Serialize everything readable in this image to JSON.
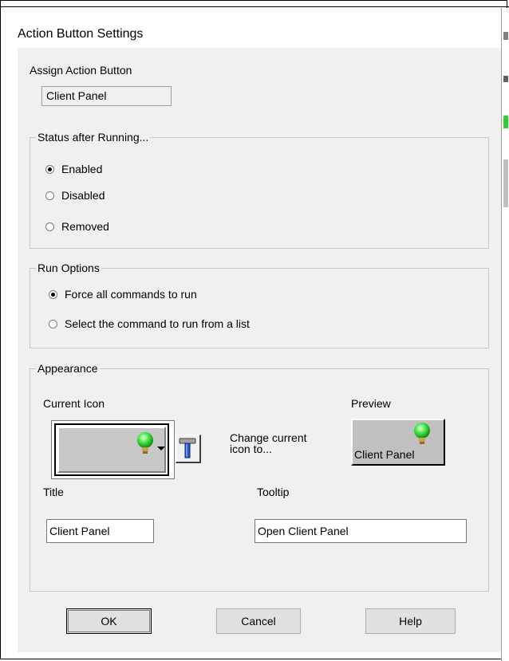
{
  "dialog": {
    "title": "Action Button Settings"
  },
  "assign": {
    "label": "Assign Action Button",
    "value": "Client Panel"
  },
  "status_after_running": {
    "caption": "Status after Running...",
    "options": [
      {
        "label": "Enabled",
        "checked": true
      },
      {
        "label": "Disabled",
        "checked": false
      },
      {
        "label": "Removed",
        "checked": false
      }
    ]
  },
  "run_options": {
    "caption": "Run Options",
    "options": [
      {
        "label": "Force all commands to run",
        "checked": true
      },
      {
        "label": "Select the command to run from a list",
        "checked": false
      }
    ]
  },
  "appearance": {
    "caption": "Appearance",
    "current_icon_label": "Current Icon",
    "change_icon_text_line1": "Change current",
    "change_icon_text_line2": "icon to...",
    "preview_label": "Preview",
    "preview_button_text": "Client Panel",
    "title_label": "Title",
    "title_value": "Client Panel",
    "tooltip_label": "Tooltip",
    "tooltip_value": "Open Client Panel",
    "icon_name": "green-lightbulb-icon"
  },
  "buttons": {
    "ok": "OK",
    "cancel": "Cancel",
    "help": "Help"
  },
  "colors": {
    "panel_bg": "#f0f0f0",
    "bulb_green": "#33dd33",
    "bulb_base": "#c8a050",
    "tool_handle_blue": "#2255cc"
  }
}
